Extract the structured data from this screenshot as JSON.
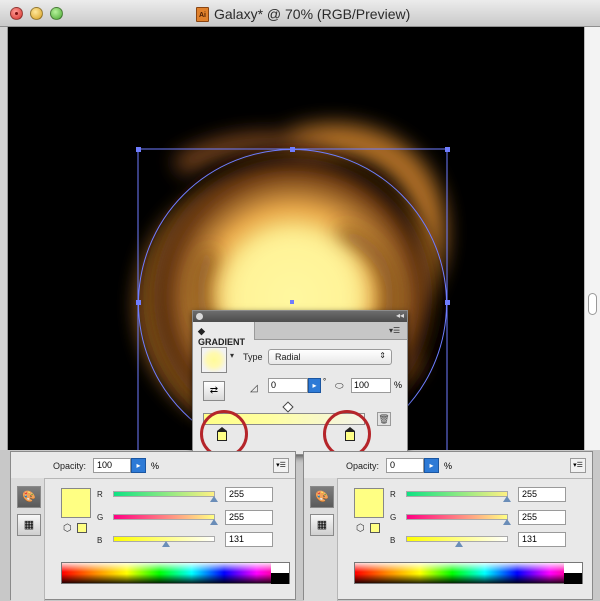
{
  "window": {
    "title": "Galaxy* @ 70% (RGB/Preview)",
    "doc_icon_text": "Ai"
  },
  "gradient_panel": {
    "tab_label": "GRADIENT",
    "type_label": "Type",
    "type_value": "Radial",
    "angle_value": "0",
    "angle_unit": "°",
    "aspect_value": "100",
    "aspect_unit": "%",
    "stop_color": "#ffff83"
  },
  "color_panels": [
    {
      "opacity_label": "Opacity:",
      "opacity_value": "100",
      "opacity_unit": "%",
      "r_label": "R",
      "r_value": "255",
      "g_label": "G",
      "g_value": "255",
      "b_label": "B",
      "b_value": "131",
      "swatch_color": "#ffff83"
    },
    {
      "opacity_label": "Opacity:",
      "opacity_value": "0",
      "opacity_unit": "%",
      "r_label": "R",
      "r_value": "255",
      "g_label": "G",
      "g_value": "255",
      "b_label": "B",
      "b_value": "131",
      "swatch_color": "#ffff83"
    }
  ],
  "colors": {
    "accent": "#2d7ad6",
    "highlight_ring": "#b5252a",
    "canvas": "#000000"
  }
}
